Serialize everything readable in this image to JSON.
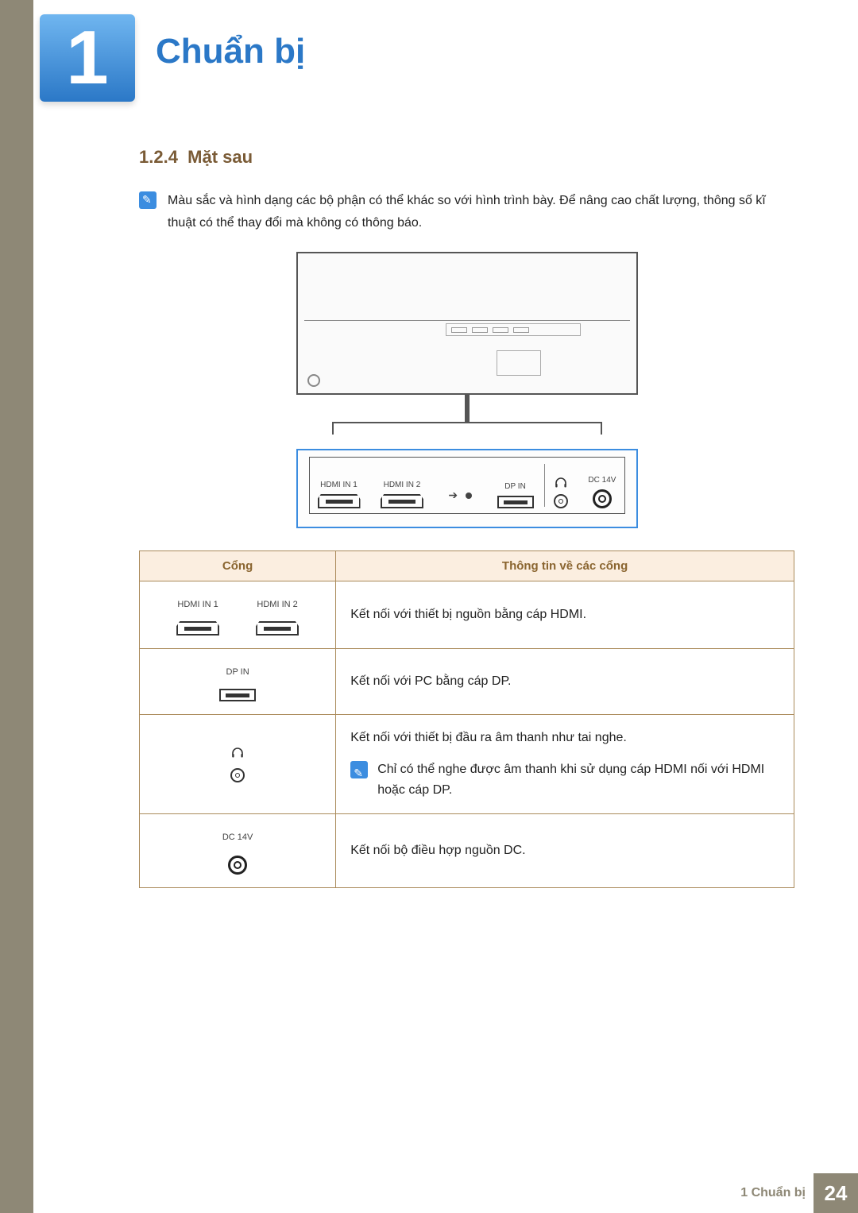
{
  "chapter": {
    "number": "1",
    "title": "Chuẩn bị"
  },
  "section": {
    "number": "1.2.4",
    "title": "Mặt sau"
  },
  "note": "Màu sắc và hình dạng các bộ phận có thể khác so với hình trình bày. Để nâng cao chất lượng, thông số kĩ thuật có thể thay đổi mà không có thông báo.",
  "port_panel": {
    "hdmi1": "HDMI IN 1",
    "hdmi2": "HDMI IN 2",
    "dp": "DP IN",
    "dc": "DC 14V"
  },
  "table": {
    "header_port": "Cổng",
    "header_desc": "Thông tin về các cổng",
    "rows": [
      {
        "port_labels": {
          "a": "HDMI IN 1",
          "b": "HDMI IN 2"
        },
        "desc": "Kết nối với thiết bị nguồn bằng cáp HDMI."
      },
      {
        "port_labels": {
          "a": "DP IN"
        },
        "desc": "Kết nối với PC bằng cáp DP."
      },
      {
        "desc": "Kết nối với thiết bị đầu ra âm thanh như tai nghe.",
        "subnote": "Chỉ có thể nghe được âm thanh khi sử dụng cáp HDMI nối với HDMI hoặc cáp DP."
      },
      {
        "port_labels": {
          "a": "DC 14V"
        },
        "desc": "Kết nối bộ điều hợp nguồn DC."
      }
    ]
  },
  "footer": {
    "label": "1 Chuẩn bị",
    "page": "24"
  }
}
